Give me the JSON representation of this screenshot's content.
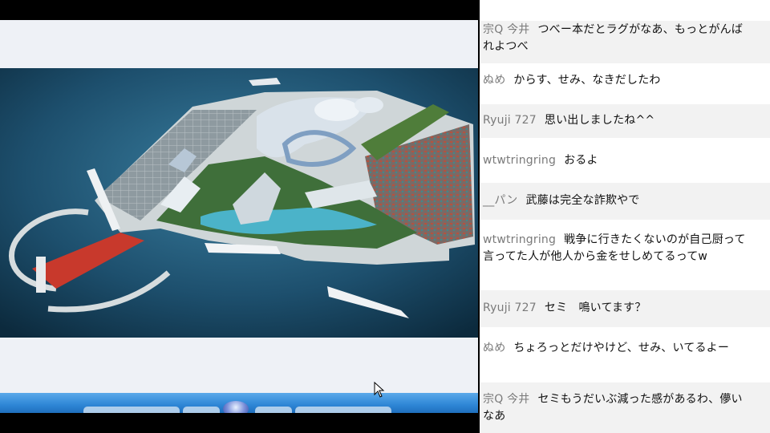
{
  "chat": {
    "messages": [
      {
        "author": "宗Q 今井",
        "text": "つべー本だとラグがなあ、もっとがんばれよつべ"
      },
      {
        "author": "ぬめ",
        "text": "からす、せみ、なきだしたわ"
      },
      {
        "author": "Ryuji 727",
        "text": "思い出しましたね^^"
      },
      {
        "author": "wtwtringring",
        "text": "おるよ"
      },
      {
        "author": "__パン",
        "text": "武藤は完全な詐欺やで"
      },
      {
        "author": "wtwtringring",
        "text": "戦争に行きたくないのが自己厨って言ってた人が他人から金をせしめてるってw"
      },
      {
        "author": "Ryuji 727",
        "text": "セミ　鳴いてます？"
      },
      {
        "author": "ぬめ",
        "text": "ちょろっとだけやけど、せみ、いてるよー"
      },
      {
        "author": "宗Q 今井",
        "text": "セミもうだいぶ減った感があるわ、儚いなあ"
      }
    ]
  },
  "colors": {
    "taskbar": "#2e86d6",
    "chat_bg": "#ffffff",
    "alt_row": "#f2f2f2",
    "author": "#7a7a7a"
  },
  "icons": {
    "cursor": "mouse-pointer-icon",
    "start": "windows-orb-icon"
  }
}
